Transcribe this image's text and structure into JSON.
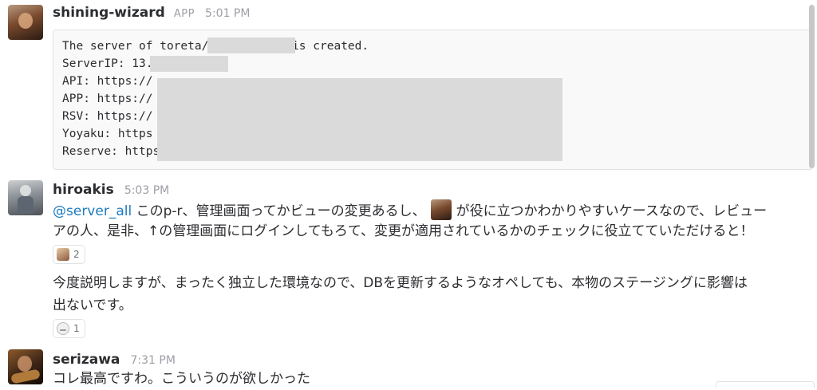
{
  "messages": [
    {
      "author": "shining-wizard",
      "badge": "APP",
      "time": "5:01 PM",
      "code_lines": [
        "The server of toreta/              /pull/3187 is created.",
        "ServerIP: 13.",
        "API: https://",
        "APP: https://",
        "RSV: https://",
        "Yoyaku: https",
        "Reserve: https:"
      ]
    },
    {
      "author": "hiroakis",
      "time": "5:03 PM",
      "mention": "@server_all",
      "line1_a": "このp-r、管理画面ってかビューの変更あるし、",
      "line1_b": "が役に立つかわかりやすいケースなので、レビュー",
      "line2": "アの人、是非、↑の管理画面にログインしてもろて、変更が適用されているかのチェックに役立てていただけると！",
      "reaction1_count": "2",
      "line3": "今度説明しますが、まったく独立した環境なので、DBを更新するようなオペしても、本物のステージングに影響は",
      "line4": "出ないです。",
      "reaction2_count": "1"
    },
    {
      "author": "serizawa",
      "time": "7:31 PM",
      "text": "コレ最高ですわ。こういうのが欲しかった"
    }
  ]
}
